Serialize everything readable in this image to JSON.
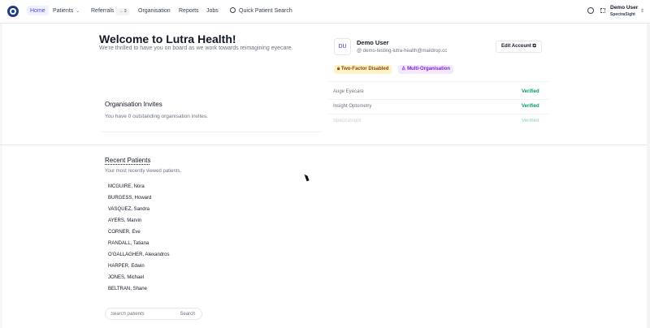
{
  "nav": {
    "home": "Home",
    "patients": "Patients",
    "referrals": "Referrals",
    "referrals_count": "→ 3",
    "organisation": "Organisation",
    "reports": "Reports",
    "jobs": "Jobs",
    "quick_search": "Quick Patient Search"
  },
  "user": {
    "name": "Demo User",
    "org": "SpectraSight"
  },
  "welcome": {
    "title": "Welcome to Lutra Health!",
    "subtitle": "We're thrilled to have you on board as we work towards reimagining eyecare."
  },
  "account": {
    "initials": "DU",
    "name": "Demo User",
    "email": "demo-testing-lutra-health@maildrop.cc",
    "edit_label": "Edit Account",
    "two_factor": "Two-Factor Disabled",
    "multi_org": "Multi-Organisation"
  },
  "organisations": [
    {
      "name": "Auge Eyecare",
      "status": "Verified"
    },
    {
      "name": "Insight Optometry",
      "status": "Verified"
    },
    {
      "name": "SpectraSight",
      "status": "Verified"
    }
  ],
  "invites": {
    "title": "Organisation Invites",
    "message": "You have 0 outstanding organisation invites."
  },
  "recent": {
    "title": "Recent Patients",
    "subtitle": "Your most recently viewed patients.",
    "patients": [
      "MCGUIRE, Nora",
      "BURGESS, Howard",
      "VASQUEZ, Sandra",
      "AYERS, Marvin",
      "CORNER, Eve",
      "RANDALL, Tatiana",
      "O'GALLAGHER, Alexandros",
      "HARPER, Edwin",
      "JONES, Michael",
      "BELTRAN, Shane"
    ],
    "search_placeholder": "Search patients",
    "search_button": "Search"
  },
  "icons": {
    "logo": "lutra-logo-icon",
    "search": "search-icon",
    "settings": "gear-icon",
    "apps": "grid-icon",
    "edit": "external-link-icon",
    "lock": "lock-icon",
    "users": "users-icon",
    "email": "at-icon"
  },
  "colors": {
    "accent": "#4f46e5",
    "verified": "#059669",
    "warning_bg": "#fef3c7",
    "multi_bg": "#f3e8ff"
  }
}
